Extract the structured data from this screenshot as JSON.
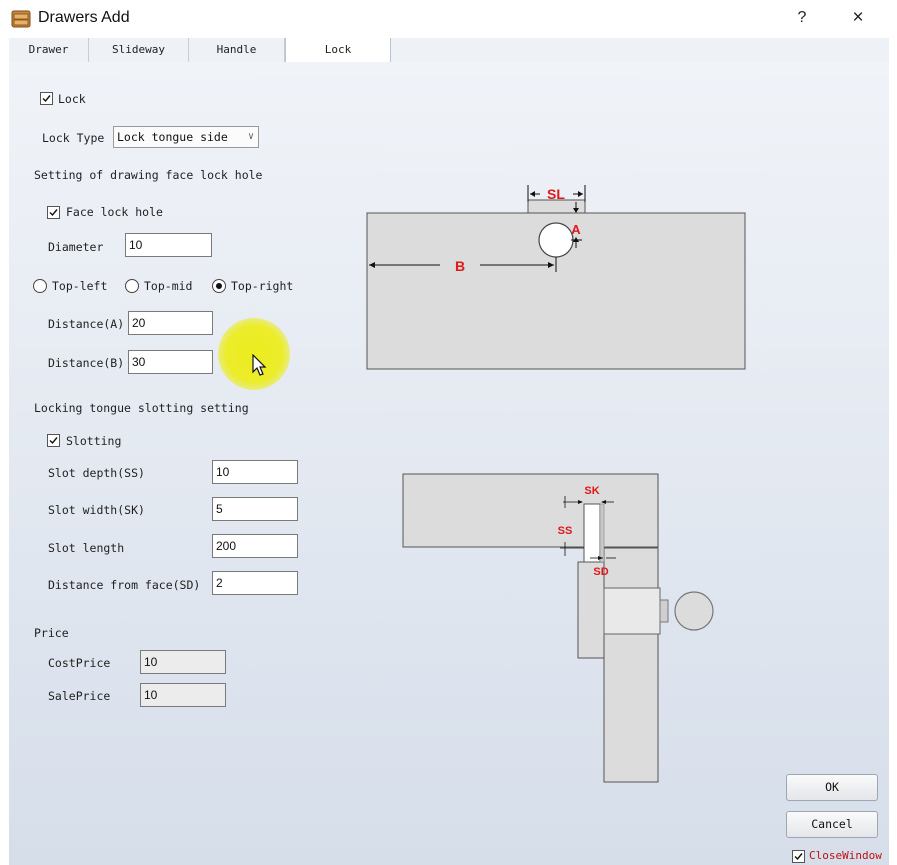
{
  "window": {
    "title": "Drawers Add",
    "help": "?",
    "close": "×"
  },
  "tabs": [
    {
      "label": "Drawer",
      "active": false
    },
    {
      "label": "Slideway",
      "active": false
    },
    {
      "label": "Handle",
      "active": false
    },
    {
      "label": "Lock",
      "active": true
    }
  ],
  "lock": {
    "enabled_label": "Lock",
    "enabled": true,
    "type_label": "Lock Type",
    "type_value": "Lock tongue side"
  },
  "face_hole": {
    "section_title": "Setting of drawing face lock hole",
    "enabled_label": "Face lock hole",
    "enabled": true,
    "diameter_label": "Diameter",
    "diameter_value": "10",
    "positions": [
      {
        "label": "Top-left",
        "selected": false
      },
      {
        "label": "Top-mid",
        "selected": false
      },
      {
        "label": "Top-right",
        "selected": true
      }
    ],
    "distance_a_label": "Distance(A)",
    "distance_a_value": "20",
    "distance_b_label": "Distance(B)",
    "distance_b_value": "30"
  },
  "slotting": {
    "section_title": "Locking tongue slotting setting",
    "enabled_label": "Slotting",
    "enabled": true,
    "depth_label": "Slot depth(SS)",
    "depth_value": "10",
    "width_label": "Slot width(SK)",
    "width_value": "5",
    "length_label": "Slot length",
    "length_value": "200",
    "face_distance_label": "Distance from face(SD)",
    "face_distance_value": "2"
  },
  "price": {
    "section_title": "Price",
    "cost_label": "CostPrice",
    "cost_value": "10",
    "sale_label": "SalePrice",
    "sale_value": "10"
  },
  "diagram_top": {
    "sl_label": "SL",
    "a_label": "A",
    "b_label": "B"
  },
  "diagram_bottom": {
    "sk_label": "SK",
    "ss_label": "SS",
    "sd_label": "SD"
  },
  "footer": {
    "ok_label": "OK",
    "cancel_label": "Cancel",
    "close_window_label": "CloseWindow",
    "close_window_checked": true
  },
  "colors": {
    "dimension_red": "#e01818",
    "part_fill": "#dcdcdc",
    "highlight_yellow": "#ecec14"
  }
}
